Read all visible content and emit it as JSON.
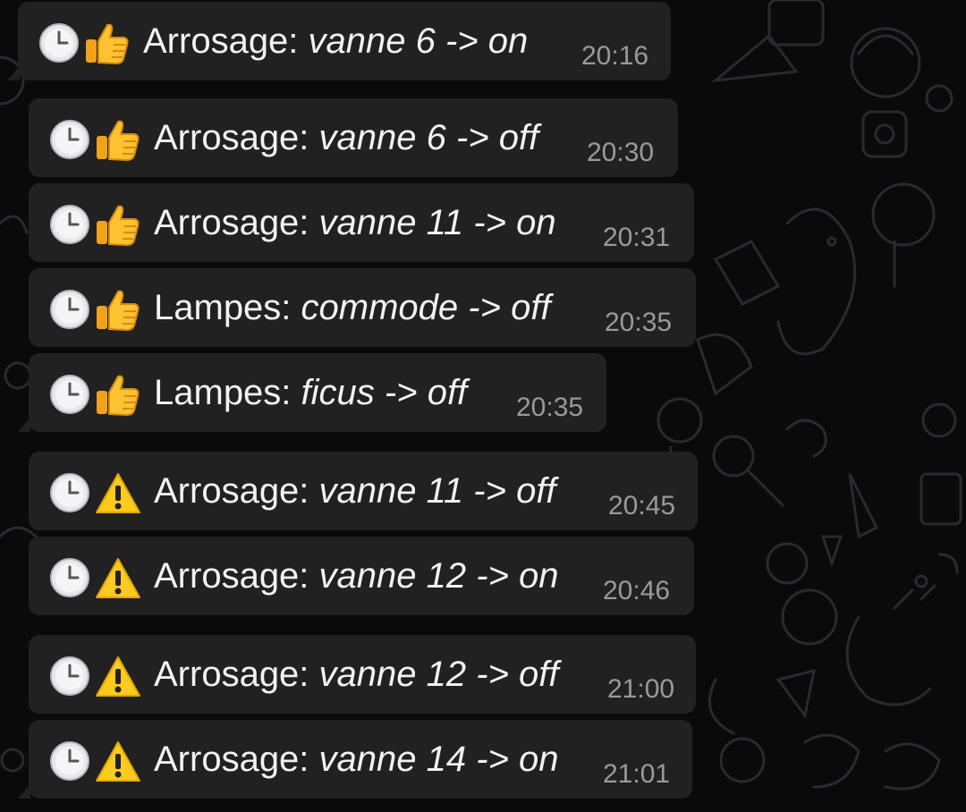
{
  "colors": {
    "background": "#0a0a0a",
    "bubble": "#212121",
    "message_text": "#f2f2f2",
    "timestamp_text": "#9a9a9a"
  },
  "messages": [
    {
      "icon": "clock-icon",
      "status_icon": "thumbs-up-icon",
      "category": "Arrosage:",
      "detail": "vanne 6 -> on",
      "time": "20:16"
    },
    {
      "icon": "clock-icon",
      "status_icon": "thumbs-up-icon",
      "category": "Arrosage:",
      "detail": "vanne 6 -> off",
      "time": "20:30"
    },
    {
      "icon": "clock-icon",
      "status_icon": "thumbs-up-icon",
      "category": "Arrosage:",
      "detail": "vanne 11 -> on",
      "time": "20:31"
    },
    {
      "icon": "clock-icon",
      "status_icon": "thumbs-up-icon",
      "category": "Lampes:",
      "detail": "commode -> off",
      "time": "20:35"
    },
    {
      "icon": "clock-icon",
      "status_icon": "thumbs-up-icon",
      "category": "Lampes:",
      "detail": "ficus -> off",
      "time": "20:35"
    },
    {
      "icon": "clock-icon",
      "status_icon": "warning-icon",
      "category": "Arrosage:",
      "detail": "vanne 11 -> off",
      "time": "20:45"
    },
    {
      "icon": "clock-icon",
      "status_icon": "warning-icon",
      "category": "Arrosage:",
      "detail": "vanne 12 -> on",
      "time": "20:46"
    },
    {
      "icon": "clock-icon",
      "status_icon": "warning-icon",
      "category": "Arrosage:",
      "detail": "vanne 12 -> off",
      "time": "21:00"
    },
    {
      "icon": "clock-icon",
      "status_icon": "warning-icon",
      "category": "Arrosage:",
      "detail": "vanne 14 -> on",
      "time": "21:01"
    }
  ]
}
